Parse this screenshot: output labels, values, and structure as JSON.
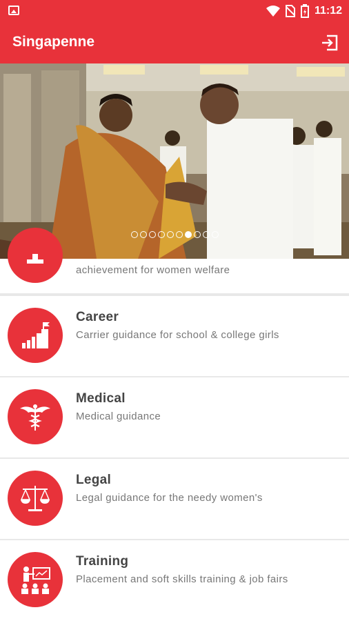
{
  "status_bar": {
    "time": "11:12",
    "icons": [
      "image-icon",
      "wifi-icon",
      "no-sim-icon",
      "battery-icon"
    ]
  },
  "app_bar": {
    "title": "Singapenne",
    "action_icon": "logout-icon"
  },
  "banner": {
    "slide_count": 10,
    "active_slide": 6
  },
  "menu": {
    "items": [
      {
        "id": "achievement",
        "icon": "award-icon",
        "title": "",
        "description": "achievement for women welfare"
      },
      {
        "id": "career",
        "icon": "career-growth-icon",
        "title": "Career",
        "description": "Carrier guidance for school & college girls"
      },
      {
        "id": "medical",
        "icon": "caduceus-icon",
        "title": "Medical",
        "description": "Medical guidance"
      },
      {
        "id": "legal",
        "icon": "scales-icon",
        "title": "Legal",
        "description": "Legal guidance for the needy women's"
      },
      {
        "id": "training",
        "icon": "training-board-icon",
        "title": "Training",
        "description": "Placement and soft skills training & job fairs"
      }
    ]
  },
  "colors": {
    "primary": "#e8323a",
    "title_text": "#444444",
    "desc_text": "#777777",
    "divider": "#e8e8e8"
  }
}
